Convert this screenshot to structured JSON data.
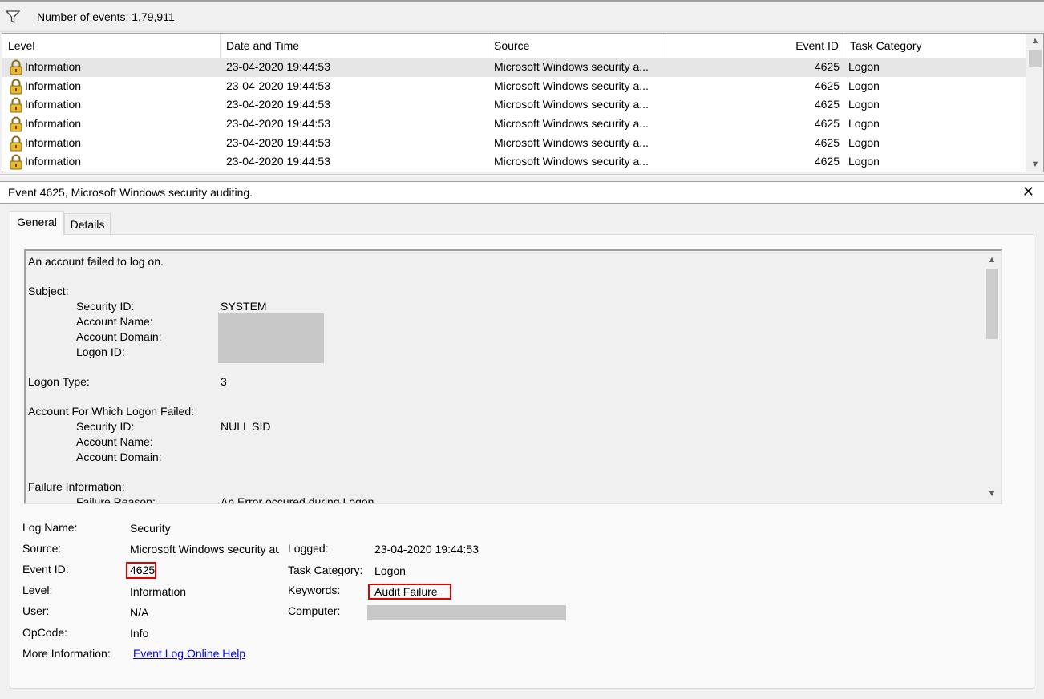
{
  "events_bar": {
    "count_text": "Number of events: 1,79,911"
  },
  "grid": {
    "columns": [
      "Level",
      "Date and Time",
      "Source",
      "Event ID",
      "Task Category"
    ],
    "rows": [
      {
        "level": "Information",
        "date": "23-04-2020 19:44:53",
        "source": "Microsoft Windows security a...",
        "event_id": "4625",
        "category": "Logon"
      },
      {
        "level": "Information",
        "date": "23-04-2020 19:44:53",
        "source": "Microsoft Windows security a...",
        "event_id": "4625",
        "category": "Logon"
      },
      {
        "level": "Information",
        "date": "23-04-2020 19:44:53",
        "source": "Microsoft Windows security a...",
        "event_id": "4625",
        "category": "Logon"
      },
      {
        "level": "Information",
        "date": "23-04-2020 19:44:53",
        "source": "Microsoft Windows security a...",
        "event_id": "4625",
        "category": "Logon"
      },
      {
        "level": "Information",
        "date": "23-04-2020 19:44:53",
        "source": "Microsoft Windows security a...",
        "event_id": "4625",
        "category": "Logon"
      },
      {
        "level": "Information",
        "date": "23-04-2020 19:44:53",
        "source": "Microsoft Windows security a...",
        "event_id": "4625",
        "category": "Logon"
      }
    ]
  },
  "detail": {
    "title": "Event 4625, Microsoft Windows security auditing.",
    "close_glyph": "✕",
    "tabs": [
      "General",
      "Details"
    ],
    "description": {
      "intro": "An account failed to log on.",
      "subject_header": "Subject:",
      "security_id_label": "Security ID:",
      "security_id_value": "SYSTEM",
      "account_name_label": "Account Name:",
      "account_domain_label": "Account Domain:",
      "logon_id_label": "Logon ID:",
      "logon_type_label": "Logon Type:",
      "logon_type_value": "3",
      "failed_header": "Account For Which Logon Failed:",
      "failed_security_id_label": "Security ID:",
      "failed_security_id_value": "NULL SID",
      "failed_account_name_label": "Account Name:",
      "failed_account_domain_label": "Account Domain:",
      "failure_header": "Failure Information:",
      "failure_reason_label": "Failure Reason:",
      "failure_reason_value": "An Error occured during Logon."
    },
    "properties": {
      "log_name_label": "Log Name:",
      "log_name_value": "Security",
      "source_label": "Source:",
      "source_value": "Microsoft Windows security auditing.",
      "logged_label": "Logged:",
      "logged_value": "23-04-2020 19:44:53",
      "event_id_label": "Event ID:",
      "event_id_value": "4625",
      "task_category_label": "Task Category:",
      "task_category_value": "Logon",
      "level_label": "Level:",
      "level_value": "Information",
      "keywords_label": "Keywords:",
      "keywords_value": "Audit Failure",
      "user_label": "User:",
      "user_value": "N/A",
      "computer_label": "Computer:",
      "opcode_label": "OpCode:",
      "opcode_value": "Info",
      "more_info_label": "More Information:",
      "more_info_link": "Event Log Online Help"
    }
  },
  "colors": {
    "highlight_box": "#e00000",
    "link": "#0000ee",
    "selected_row": "#e6e6e6",
    "redaction": "#c8c8c8"
  },
  "icons": {
    "filter": "filter-icon",
    "row_level": "lock-icon",
    "close": "close-icon"
  }
}
